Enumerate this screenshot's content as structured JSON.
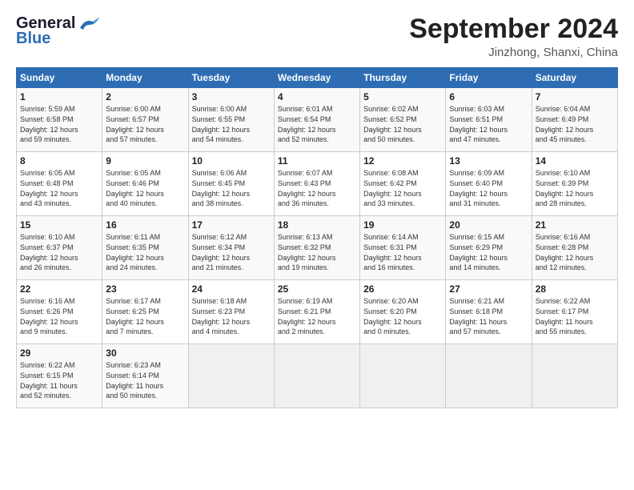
{
  "header": {
    "logo_line1": "General",
    "logo_line2": "Blue",
    "month_title": "September 2024",
    "location": "Jinzhong, Shanxi, China"
  },
  "weekdays": [
    "Sunday",
    "Monday",
    "Tuesday",
    "Wednesday",
    "Thursday",
    "Friday",
    "Saturday"
  ],
  "weeks": [
    [
      {
        "day": "1",
        "lines": [
          "Sunrise: 5:59 AM",
          "Sunset: 6:58 PM",
          "Daylight: 12 hours",
          "and 59 minutes."
        ]
      },
      {
        "day": "2",
        "lines": [
          "Sunrise: 6:00 AM",
          "Sunset: 6:57 PM",
          "Daylight: 12 hours",
          "and 57 minutes."
        ]
      },
      {
        "day": "3",
        "lines": [
          "Sunrise: 6:00 AM",
          "Sunset: 6:55 PM",
          "Daylight: 12 hours",
          "and 54 minutes."
        ]
      },
      {
        "day": "4",
        "lines": [
          "Sunrise: 6:01 AM",
          "Sunset: 6:54 PM",
          "Daylight: 12 hours",
          "and 52 minutes."
        ]
      },
      {
        "day": "5",
        "lines": [
          "Sunrise: 6:02 AM",
          "Sunset: 6:52 PM",
          "Daylight: 12 hours",
          "and 50 minutes."
        ]
      },
      {
        "day": "6",
        "lines": [
          "Sunrise: 6:03 AM",
          "Sunset: 6:51 PM",
          "Daylight: 12 hours",
          "and 47 minutes."
        ]
      },
      {
        "day": "7",
        "lines": [
          "Sunrise: 6:04 AM",
          "Sunset: 6:49 PM",
          "Daylight: 12 hours",
          "and 45 minutes."
        ]
      }
    ],
    [
      {
        "day": "8",
        "lines": [
          "Sunrise: 6:05 AM",
          "Sunset: 6:48 PM",
          "Daylight: 12 hours",
          "and 43 minutes."
        ]
      },
      {
        "day": "9",
        "lines": [
          "Sunrise: 6:05 AM",
          "Sunset: 6:46 PM",
          "Daylight: 12 hours",
          "and 40 minutes."
        ]
      },
      {
        "day": "10",
        "lines": [
          "Sunrise: 6:06 AM",
          "Sunset: 6:45 PM",
          "Daylight: 12 hours",
          "and 38 minutes."
        ]
      },
      {
        "day": "11",
        "lines": [
          "Sunrise: 6:07 AM",
          "Sunset: 6:43 PM",
          "Daylight: 12 hours",
          "and 36 minutes."
        ]
      },
      {
        "day": "12",
        "lines": [
          "Sunrise: 6:08 AM",
          "Sunset: 6:42 PM",
          "Daylight: 12 hours",
          "and 33 minutes."
        ]
      },
      {
        "day": "13",
        "lines": [
          "Sunrise: 6:09 AM",
          "Sunset: 6:40 PM",
          "Daylight: 12 hours",
          "and 31 minutes."
        ]
      },
      {
        "day": "14",
        "lines": [
          "Sunrise: 6:10 AM",
          "Sunset: 6:39 PM",
          "Daylight: 12 hours",
          "and 28 minutes."
        ]
      }
    ],
    [
      {
        "day": "15",
        "lines": [
          "Sunrise: 6:10 AM",
          "Sunset: 6:37 PM",
          "Daylight: 12 hours",
          "and 26 minutes."
        ]
      },
      {
        "day": "16",
        "lines": [
          "Sunrise: 6:11 AM",
          "Sunset: 6:35 PM",
          "Daylight: 12 hours",
          "and 24 minutes."
        ]
      },
      {
        "day": "17",
        "lines": [
          "Sunrise: 6:12 AM",
          "Sunset: 6:34 PM",
          "Daylight: 12 hours",
          "and 21 minutes."
        ]
      },
      {
        "day": "18",
        "lines": [
          "Sunrise: 6:13 AM",
          "Sunset: 6:32 PM",
          "Daylight: 12 hours",
          "and 19 minutes."
        ]
      },
      {
        "day": "19",
        "lines": [
          "Sunrise: 6:14 AM",
          "Sunset: 6:31 PM",
          "Daylight: 12 hours",
          "and 16 minutes."
        ]
      },
      {
        "day": "20",
        "lines": [
          "Sunrise: 6:15 AM",
          "Sunset: 6:29 PM",
          "Daylight: 12 hours",
          "and 14 minutes."
        ]
      },
      {
        "day": "21",
        "lines": [
          "Sunrise: 6:16 AM",
          "Sunset: 6:28 PM",
          "Daylight: 12 hours",
          "and 12 minutes."
        ]
      }
    ],
    [
      {
        "day": "22",
        "lines": [
          "Sunrise: 6:16 AM",
          "Sunset: 6:26 PM",
          "Daylight: 12 hours",
          "and 9 minutes."
        ]
      },
      {
        "day": "23",
        "lines": [
          "Sunrise: 6:17 AM",
          "Sunset: 6:25 PM",
          "Daylight: 12 hours",
          "and 7 minutes."
        ]
      },
      {
        "day": "24",
        "lines": [
          "Sunrise: 6:18 AM",
          "Sunset: 6:23 PM",
          "Daylight: 12 hours",
          "and 4 minutes."
        ]
      },
      {
        "day": "25",
        "lines": [
          "Sunrise: 6:19 AM",
          "Sunset: 6:21 PM",
          "Daylight: 12 hours",
          "and 2 minutes."
        ]
      },
      {
        "day": "26",
        "lines": [
          "Sunrise: 6:20 AM",
          "Sunset: 6:20 PM",
          "Daylight: 12 hours",
          "and 0 minutes."
        ]
      },
      {
        "day": "27",
        "lines": [
          "Sunrise: 6:21 AM",
          "Sunset: 6:18 PM",
          "Daylight: 11 hours",
          "and 57 minutes."
        ]
      },
      {
        "day": "28",
        "lines": [
          "Sunrise: 6:22 AM",
          "Sunset: 6:17 PM",
          "Daylight: 11 hours",
          "and 55 minutes."
        ]
      }
    ],
    [
      {
        "day": "29",
        "lines": [
          "Sunrise: 6:22 AM",
          "Sunset: 6:15 PM",
          "Daylight: 11 hours",
          "and 52 minutes."
        ]
      },
      {
        "day": "30",
        "lines": [
          "Sunrise: 6:23 AM",
          "Sunset: 6:14 PM",
          "Daylight: 11 hours",
          "and 50 minutes."
        ]
      },
      {
        "day": "",
        "lines": []
      },
      {
        "day": "",
        "lines": []
      },
      {
        "day": "",
        "lines": []
      },
      {
        "day": "",
        "lines": []
      },
      {
        "day": "",
        "lines": []
      }
    ]
  ]
}
